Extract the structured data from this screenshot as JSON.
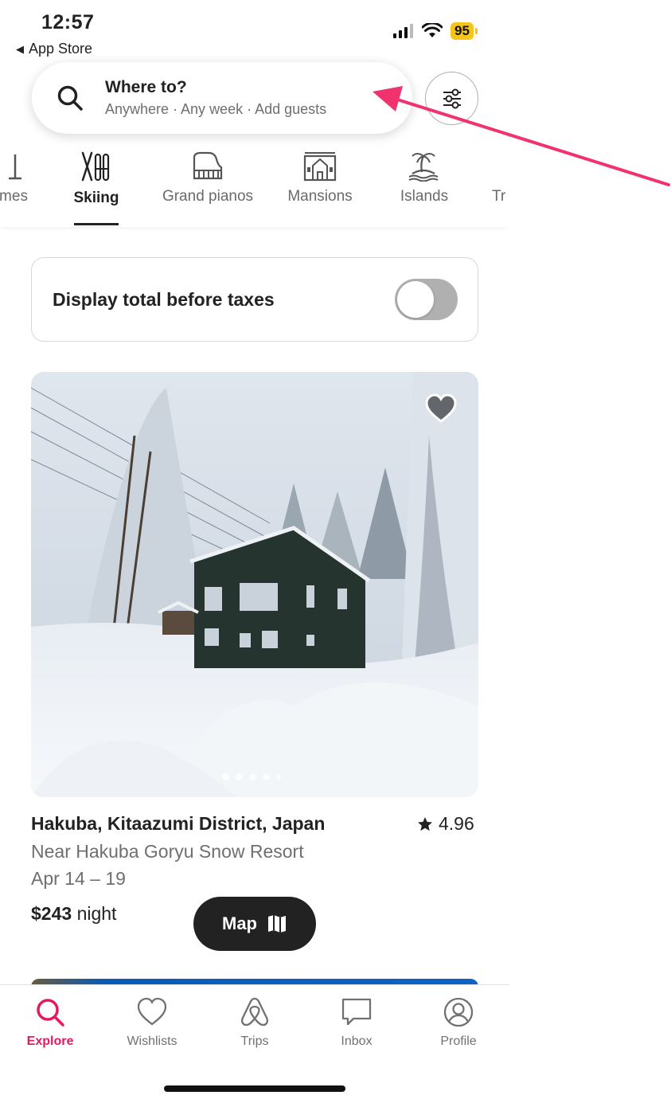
{
  "status_bar": {
    "time": "12:57",
    "back_label": "App Store",
    "battery": "95"
  },
  "search": {
    "title": "Where to?",
    "subtitle": "Anywhere · Any week · Add guests"
  },
  "categories": [
    {
      "label": "mes",
      "icon": "homes-icon"
    },
    {
      "label": "Skiing",
      "icon": "skiing-icon",
      "active": true
    },
    {
      "label": "Grand pianos",
      "icon": "grand-piano-icon"
    },
    {
      "label": "Mansions",
      "icon": "mansion-icon"
    },
    {
      "label": "Islands",
      "icon": "island-icon"
    },
    {
      "label": "Tr",
      "icon": "trending-icon"
    }
  ],
  "tax_toggle": {
    "label": "Display total before taxes",
    "on": false
  },
  "listing": {
    "title": "Hakuba, Kitaazumi District, Japan",
    "rating": "4.96",
    "subtitle": "Near Hakuba Goryu Snow Resort",
    "dates": "Apr 14 – 19",
    "price": "$243",
    "price_unit": "night",
    "photo_index": 1,
    "photo_count": 5
  },
  "map_button": {
    "label": "Map"
  },
  "tab_bar": [
    {
      "label": "Explore",
      "icon": "search-icon",
      "active": true
    },
    {
      "label": "Wishlists",
      "icon": "heart-icon"
    },
    {
      "label": "Trips",
      "icon": "airbnb-logo-icon"
    },
    {
      "label": "Inbox",
      "icon": "message-icon"
    },
    {
      "label": "Profile",
      "icon": "profile-icon"
    }
  ],
  "colors": {
    "accent": "#e31c5f",
    "annotation_arrow": "#f0326e",
    "battery": "#f5c518"
  }
}
